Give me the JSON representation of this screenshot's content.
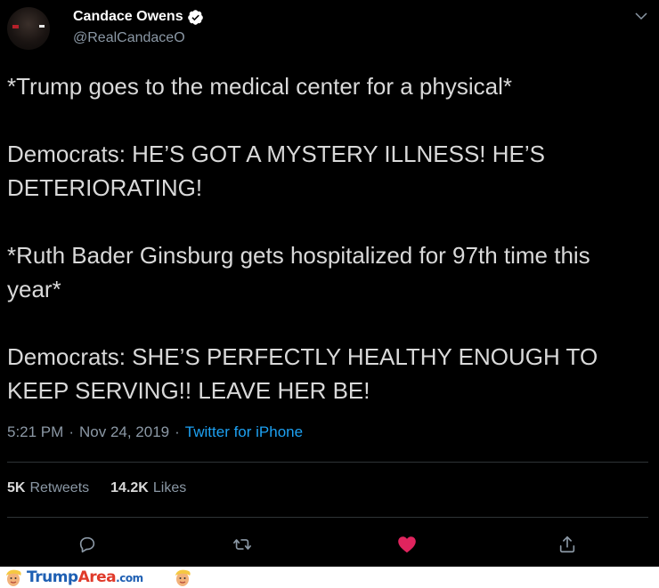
{
  "author": {
    "display_name": "Candace Owens",
    "handle": "@RealCandaceO",
    "verified": true
  },
  "tweet": {
    "paragraphs": [
      "*Trump goes to the medical center for a physical*",
      "Democrats: HE’S GOT A MYSTERY ILLNESS! HE’S DETERIORATING!",
      "*Ruth Bader Ginsburg gets hospitalized for 97th time this year*",
      "Democrats: SHE’S PERFECTLY HEALTHY ENOUGH TO KEEP SERVING!! LEAVE HER BE!"
    ],
    "time": "5:21 PM",
    "separator": "·",
    "date": "Nov 24, 2019",
    "source": "Twitter for iPhone"
  },
  "stats": {
    "retweets_count": "5K",
    "retweets_label": "Retweets",
    "likes_count": "14.2K",
    "likes_label": "Likes"
  },
  "actions": {
    "reply_icon": "reply-icon",
    "retweet_icon": "retweet-icon",
    "like_icon": "heart-filled-icon",
    "share_icon": "share-icon",
    "like_color": "#e0245e"
  },
  "footer": {
    "brand_part1": "Trump",
    "brand_part2": "Area",
    "brand_part3": ".com"
  },
  "colors": {
    "background": "#000000",
    "text": "#d9d9d9",
    "secondary": "#8b98a5",
    "link": "#1da1f2",
    "verified": "#ffffff"
  }
}
